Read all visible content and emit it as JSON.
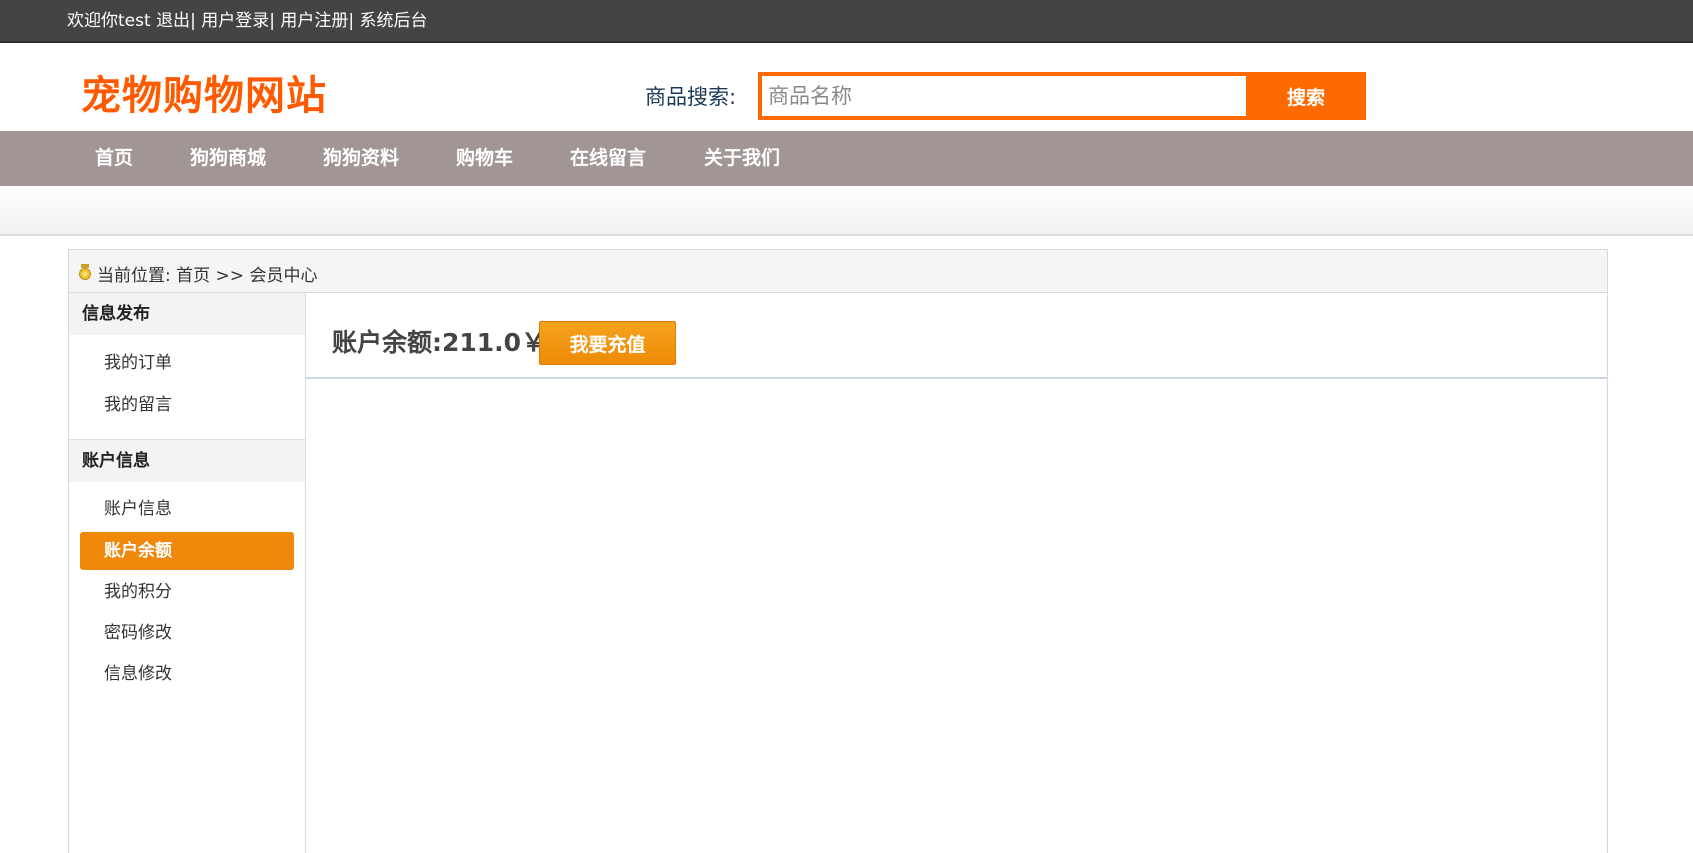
{
  "topbar": {
    "welcome": "欢迎你test",
    "logout": "退出",
    "login": "用户登录",
    "register": "用户注册",
    "admin": "系统后台",
    "separator": "|"
  },
  "header": {
    "logo": "宠物购物网站",
    "search_label": "商品搜索:",
    "search_placeholder": "商品名称",
    "search_value": "",
    "search_button": "搜索"
  },
  "nav": {
    "items": [
      {
        "label": "首页"
      },
      {
        "label": "狗狗商城"
      },
      {
        "label": "狗狗资料"
      },
      {
        "label": "购物车"
      },
      {
        "label": "在线留言"
      },
      {
        "label": "关于我们"
      }
    ]
  },
  "breadcrumb": {
    "prefix": "当前位置:",
    "home": "首页",
    "arrow": ">>",
    "current": "会员中心"
  },
  "sidebar": {
    "groups": [
      {
        "title": "信息发布",
        "items": [
          {
            "label": "我的订单"
          },
          {
            "label": "我的留言"
          }
        ]
      },
      {
        "title": "账户信息",
        "items": [
          {
            "label": "账户信息"
          },
          {
            "label": "账户余额",
            "active": true
          },
          {
            "label": "我的积分"
          },
          {
            "label": "密码修改"
          },
          {
            "label": "信息修改"
          }
        ]
      }
    ]
  },
  "main": {
    "balance_text": "账户余额:211.0￥",
    "recharge_button": "我要充值"
  },
  "colors": {
    "topbar": "#444444",
    "logo": "#ff5a00",
    "search_accent": "#ff6a00",
    "navbar": "#a29595",
    "active_item": "#f0880c",
    "recharge": "#ee8a06"
  },
  "icons": {
    "breadcrumb": "medal-icon"
  }
}
